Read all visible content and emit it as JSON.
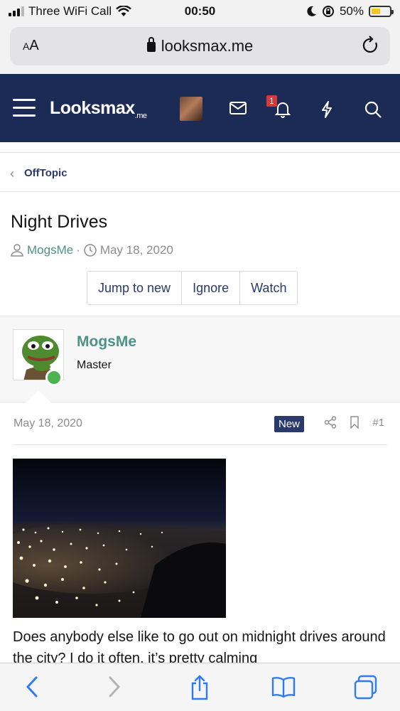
{
  "status_bar": {
    "carrier": "Three WiFi Call",
    "time": "00:50",
    "battery": "50%",
    "battery_level": 0.5
  },
  "browser": {
    "text_size_label": "AA",
    "url": "looksmax.me"
  },
  "header": {
    "logo_main": "Looksmax",
    "logo_suffix": ".me",
    "alert_count": "1",
    "colors": {
      "bar": "#1c2a56",
      "badge": "#d03b3b"
    }
  },
  "breadcrumb": {
    "label": "OffTopic"
  },
  "thread": {
    "title": "Night Drives",
    "author": "MogsMe",
    "separator": "·",
    "date": "May 18, 2020",
    "buttons": [
      "Jump to new",
      "Ignore",
      "Watch"
    ]
  },
  "post": {
    "username": "MogsMe",
    "user_title": "Master",
    "date": "May 18, 2020",
    "new_badge": "New",
    "post_number": "#1",
    "body": "Does anybody else like to go out on midnight drives around the city? I do it often, it’s pretty calming"
  },
  "icons": {
    "header": [
      "menu-icon",
      "envelope-icon",
      "bell-icon",
      "bolt-icon",
      "search-icon"
    ],
    "toolbar": [
      "back-icon",
      "forward-icon",
      "share-icon",
      "bookmarks-icon",
      "tabs-icon"
    ]
  }
}
